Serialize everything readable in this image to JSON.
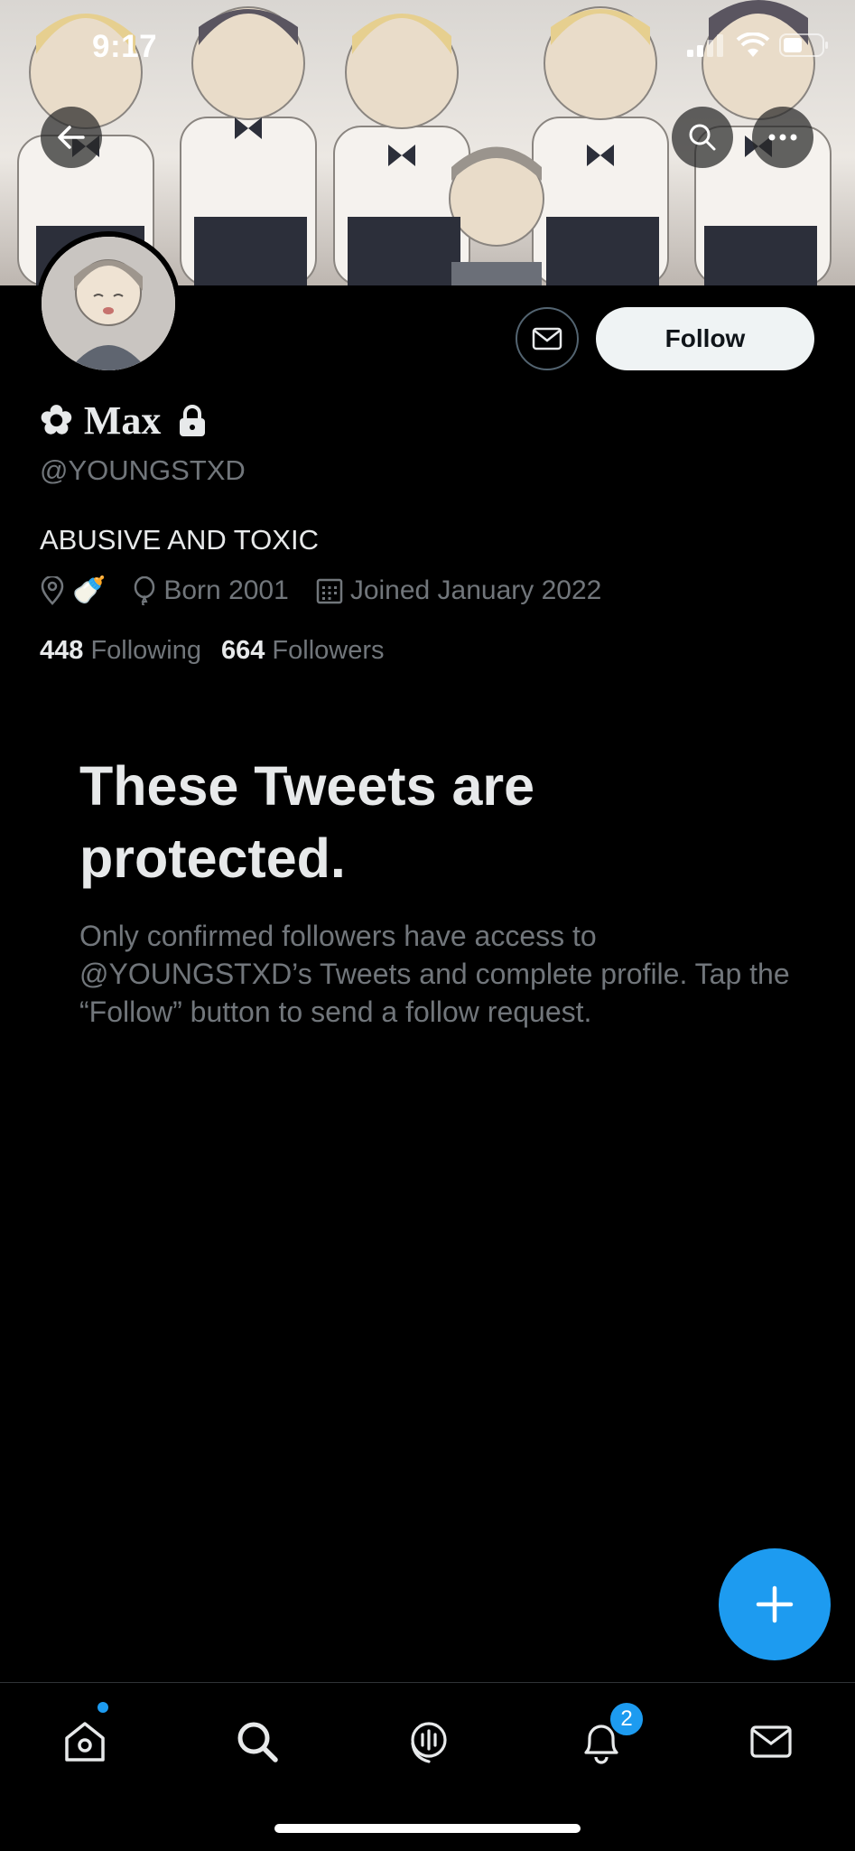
{
  "status_bar": {
    "time": "9:17"
  },
  "profile": {
    "name_prefix": "✿",
    "name": "Max",
    "handle": "@YOUNGSTXD",
    "bio": "ABUSIVE AND TOXIC",
    "location_emoji": "🍼",
    "born": "Born 2001",
    "joined": "Joined January 2022",
    "following_count": "448",
    "following_label": "Following",
    "followers_count": "664",
    "followers_label": "Followers",
    "follow_label": "Follow"
  },
  "protected": {
    "title": "These Tweets are protected.",
    "body": "Only confirmed followers have access to @YOUNGSTXD’s Tweets and complete profile. Tap the “Follow” button to send a follow request."
  },
  "tabbar": {
    "notification_count": "2"
  },
  "colors": {
    "accent": "#1d9bf0",
    "background": "#000000",
    "secondary_text": "#71767b"
  },
  "icons": [
    "back-arrow-icon",
    "search-icon",
    "more-icon",
    "mail-icon",
    "lock-icon",
    "location-icon",
    "balloon-icon",
    "calendar-icon",
    "compose-plus-icon",
    "home-icon",
    "spaces-icon",
    "bell-icon"
  ]
}
